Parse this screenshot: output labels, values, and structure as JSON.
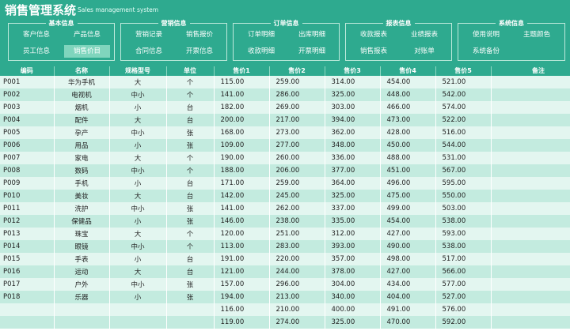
{
  "app": {
    "title": "销售管理系统",
    "subtitle": "Sales management system"
  },
  "ribbon": {
    "groups": [
      {
        "title": "基本信息",
        "buttons": [
          "客户信息",
          "产品信息",
          "员工信息",
          "销售价目"
        ]
      },
      {
        "title": "营销信息",
        "buttons": [
          "营销记录",
          "销售报价",
          "合同信息",
          "开票信息"
        ]
      },
      {
        "title": "订单信息",
        "buttons": [
          "订单明细",
          "出库明细",
          "收款明细",
          "开票明细"
        ]
      },
      {
        "title": "报表信息",
        "buttons": [
          "收款报表",
          "业绩报表",
          "销售报表",
          "对账单"
        ]
      },
      {
        "title": "系统信息",
        "buttons": [
          "使用说明",
          "主题颜色",
          "系统备份"
        ]
      }
    ],
    "active_button": "销售价目"
  },
  "table": {
    "headers": [
      "编码",
      "名称",
      "规格型号",
      "单位",
      "售价1",
      "售价2",
      "售价3",
      "售价4",
      "售价5",
      "备注"
    ],
    "rows": [
      [
        "P001",
        "华为手机",
        "大",
        "个",
        "115.00",
        "259.00",
        "314.00",
        "454.00",
        "521.00",
        ""
      ],
      [
        "P002",
        "电视机",
        "中小",
        "个",
        "141.00",
        "286.00",
        "325.00",
        "448.00",
        "542.00",
        ""
      ],
      [
        "P003",
        "烟机",
        "小",
        "台",
        "182.00",
        "269.00",
        "303.00",
        "466.00",
        "574.00",
        ""
      ],
      [
        "P004",
        "配件",
        "大",
        "台",
        "200.00",
        "217.00",
        "394.00",
        "473.00",
        "522.00",
        ""
      ],
      [
        "P005",
        "孕产",
        "中小",
        "张",
        "168.00",
        "273.00",
        "362.00",
        "428.00",
        "516.00",
        ""
      ],
      [
        "P006",
        "用品",
        "小",
        "张",
        "109.00",
        "277.00",
        "348.00",
        "450.00",
        "544.00",
        ""
      ],
      [
        "P007",
        "家电",
        "大",
        "个",
        "190.00",
        "260.00",
        "336.00",
        "488.00",
        "531.00",
        ""
      ],
      [
        "P008",
        "数码",
        "中小",
        "个",
        "188.00",
        "206.00",
        "377.00",
        "451.00",
        "567.00",
        ""
      ],
      [
        "P009",
        "手机",
        "小",
        "台",
        "171.00",
        "259.00",
        "364.00",
        "496.00",
        "595.00",
        ""
      ],
      [
        "P010",
        "美妆",
        "大",
        "台",
        "142.00",
        "245.00",
        "325.00",
        "475.00",
        "550.00",
        ""
      ],
      [
        "P011",
        "洗护",
        "中小",
        "张",
        "141.00",
        "262.00",
        "337.00",
        "499.00",
        "503.00",
        ""
      ],
      [
        "P012",
        "保健品",
        "小",
        "张",
        "146.00",
        "238.00",
        "335.00",
        "454.00",
        "538.00",
        ""
      ],
      [
        "P013",
        "珠宝",
        "大",
        "个",
        "120.00",
        "251.00",
        "312.00",
        "427.00",
        "593.00",
        ""
      ],
      [
        "P014",
        "眼镜",
        "中小",
        "个",
        "113.00",
        "283.00",
        "393.00",
        "490.00",
        "538.00",
        ""
      ],
      [
        "P015",
        "手表",
        "小",
        "台",
        "191.00",
        "220.00",
        "357.00",
        "498.00",
        "517.00",
        ""
      ],
      [
        "P016",
        "运动",
        "大",
        "台",
        "121.00",
        "244.00",
        "378.00",
        "427.00",
        "566.00",
        ""
      ],
      [
        "P017",
        "户外",
        "中小",
        "张",
        "157.00",
        "296.00",
        "304.00",
        "434.00",
        "577.00",
        ""
      ],
      [
        "P018",
        "乐器",
        "小",
        "张",
        "194.00",
        "213.00",
        "340.00",
        "404.00",
        "527.00",
        ""
      ],
      [
        "",
        "",
        "",
        "",
        "116.00",
        "210.00",
        "400.00",
        "491.00",
        "576.00",
        ""
      ],
      [
        "",
        "",
        "",
        "",
        "119.00",
        "274.00",
        "325.00",
        "470.00",
        "592.00",
        ""
      ]
    ]
  },
  "colors": {
    "header_bg": "#2eaa8f",
    "active_button": "#7fd5bd",
    "row_light": "#e3f6f0",
    "row_dark": "#c3ebdf"
  }
}
